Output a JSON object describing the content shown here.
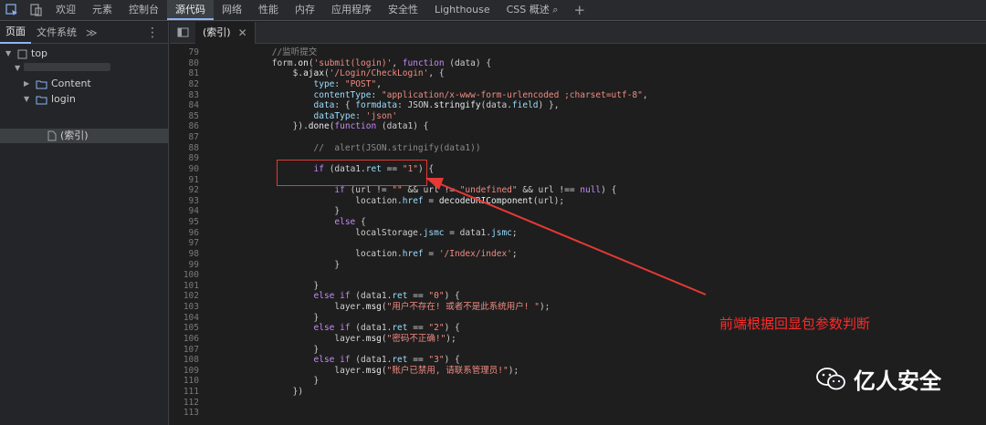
{
  "topbar": {
    "tabs": [
      {
        "label": "欢迎",
        "active": false
      },
      {
        "label": "元素",
        "active": false
      },
      {
        "label": "控制台",
        "active": false
      },
      {
        "label": "源代码",
        "active": true
      },
      {
        "label": "网络",
        "active": false
      },
      {
        "label": "性能",
        "active": false
      },
      {
        "label": "内存",
        "active": false
      },
      {
        "label": "应用程序",
        "active": false
      },
      {
        "label": "安全性",
        "active": false
      },
      {
        "label": "Lighthouse",
        "active": false
      },
      {
        "label": "CSS 概述 ⌕",
        "active": false
      }
    ],
    "add_label": "+"
  },
  "left": {
    "tabs": [
      "页面",
      "文件系统"
    ],
    "more": "≫",
    "menu": "⋮",
    "tree": {
      "top": "top",
      "content": "Content",
      "login": "login",
      "file": "(索引)"
    }
  },
  "editor": {
    "file_tab": "(索引)",
    "close": "✕",
    "lines": [
      {
        "n": "79",
        "html": "        <span class='c'>//监听提交</span>"
      },
      {
        "n": "80",
        "html": "        form.<span class='f'>on</span>(<span class='s'>'submit(login)'</span>, <span class='k'>function</span> (data) {"
      },
      {
        "n": "81",
        "html": "            $.<span class='f'>ajax</span>(<span class='s'>'/Login/CheckLogin'</span>, {"
      },
      {
        "n": "82",
        "html": "                <span class='p'>type</span>: <span class='s'>\"POST\"</span>,"
      },
      {
        "n": "83",
        "html": "                <span class='p'>contentType</span>: <span class='s'>\"application/x-www-form-urlencoded ;charset=utf-8\"</span>,"
      },
      {
        "n": "84",
        "html": "                <span class='p'>data</span>: { <span class='p'>formdata</span>: JSON.<span class='f'>stringify</span>(data.<span class='p'>field</span>) },"
      },
      {
        "n": "85",
        "html": "                <span class='p'>dataType</span>: <span class='s'>'json'</span>"
      },
      {
        "n": "86",
        "html": "            }).<span class='f'>done</span>(<span class='k'>function</span> (data1) {"
      },
      {
        "n": "87",
        "html": ""
      },
      {
        "n": "88",
        "html": "                <span class='c'>//  alert(JSON.stringify(data1))</span>"
      },
      {
        "n": "89",
        "html": ""
      },
      {
        "n": "90",
        "html": "                <span class='k'>if</span> (data1.<span class='p'>ret</span> == <span class='s'>\"1\"</span>) {"
      },
      {
        "n": "91",
        "html": ""
      },
      {
        "n": "92",
        "html": "                    <span class='k'>if</span> (url != <span class='s'>\"\"</span> && url != <span class='s'>\"undefined\"</span> && url !== <span class='k'>null</span>) {"
      },
      {
        "n": "93",
        "html": "                        location.<span class='p'>href</span> = <span class='f'>decodeURIComponent</span>(url);"
      },
      {
        "n": "94",
        "html": "                    }"
      },
      {
        "n": "95",
        "html": "                    <span class='k'>else</span> {"
      },
      {
        "n": "96",
        "html": "                        localStorage.<span class='p'>jsmc</span> = data1.<span class='p'>jsmc</span>;"
      },
      {
        "n": "97",
        "html": ""
      },
      {
        "n": "98",
        "html": "                        location.<span class='p'>href</span> = <span class='s'>'/Index/index'</span>;"
      },
      {
        "n": "99",
        "html": "                    }"
      },
      {
        "n": "100",
        "html": ""
      },
      {
        "n": "101",
        "html": "                }"
      },
      {
        "n": "102",
        "html": "                <span class='k'>else if</span> (data1.<span class='p'>ret</span> == <span class='s'>\"0\"</span>) {"
      },
      {
        "n": "103",
        "html": "                    layer.<span class='f'>msg</span>(<span class='s'>\"用户不存在! 或者不是此系统用户! \"</span>);"
      },
      {
        "n": "104",
        "html": "                }"
      },
      {
        "n": "105",
        "html": "                <span class='k'>else if</span> (data1.<span class='p'>ret</span> == <span class='s'>\"2\"</span>) {"
      },
      {
        "n": "106",
        "html": "                    layer.<span class='f'>msg</span>(<span class='s'>\"密码不正确!\"</span>);"
      },
      {
        "n": "107",
        "html": "                }"
      },
      {
        "n": "108",
        "html": "                <span class='k'>else if</span> (data1.<span class='p'>ret</span> == <span class='s'>\"3\"</span>) {"
      },
      {
        "n": "109",
        "html": "                    layer.<span class='f'>msg</span>(<span class='s'>\"账户已禁用, 请联系管理员!\"</span>);"
      },
      {
        "n": "110",
        "html": "                }"
      },
      {
        "n": "111",
        "html": "            })"
      },
      {
        "n": "112",
        "html": ""
      },
      {
        "n": "113",
        "html": ""
      }
    ]
  },
  "annotation": "前端根据回显包参数判断",
  "watermark": "亿人安全",
  "colors": {
    "annotation": "#ff2a2a",
    "accent": "#8ab4f8"
  }
}
